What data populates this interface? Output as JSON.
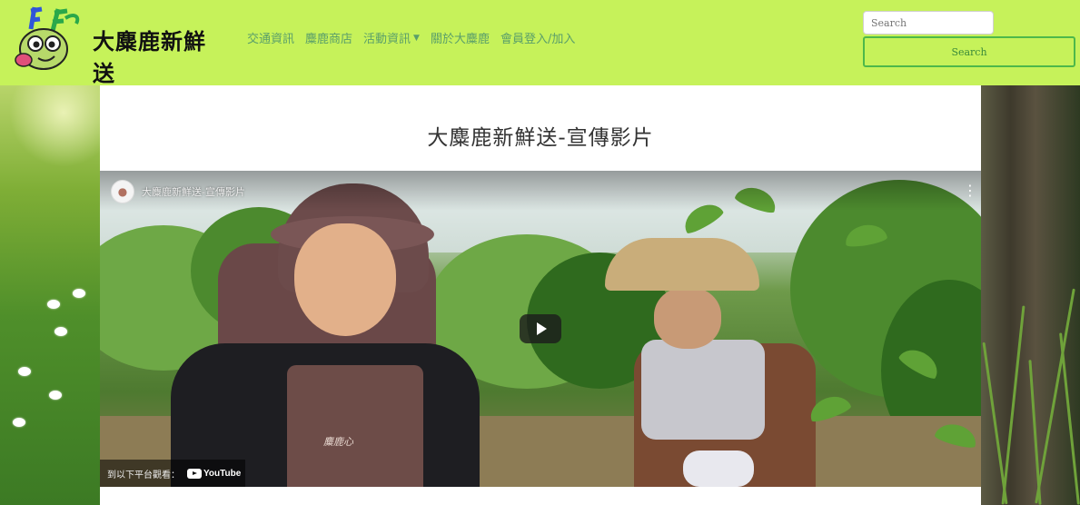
{
  "site": {
    "logo_text": "大麋鹿新鮮送",
    "logo_icon": "deer-mascot-icon"
  },
  "nav": {
    "items": [
      {
        "label": "交通資訊"
      },
      {
        "label": "麋鹿商店"
      },
      {
        "label": "活動資訊",
        "has_dropdown": true
      },
      {
        "label": "關於大麋鹿"
      },
      {
        "label": "會員登入/加入"
      }
    ]
  },
  "search": {
    "placeholder": "Search",
    "button_label": "Search"
  },
  "main": {
    "title": "大麋鹿新鮮送-宣傳影片"
  },
  "video": {
    "title": "大麋鹿新鮮送-宣傳影片",
    "watch_on_label": "到以下平台觀看：",
    "platform_label": "YouTube",
    "apron_text": "麋鹿心",
    "play_icon": "play-icon",
    "more_icon": "more-icon"
  },
  "colors": {
    "header_bg": "#c6f25a",
    "nav_text": "#5a9f6a",
    "search_border": "#4db84a"
  }
}
